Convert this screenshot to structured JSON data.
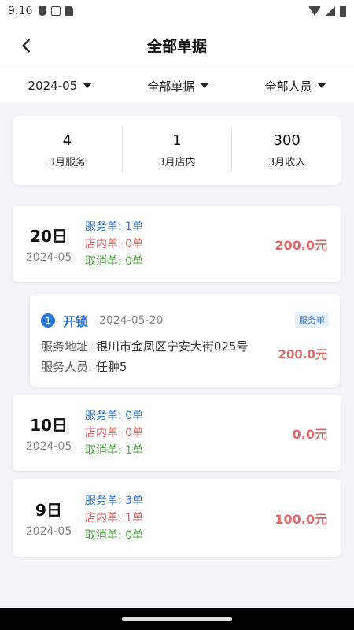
{
  "status_bar": {
    "time": "9:16"
  },
  "header": {
    "title": "全部单据"
  },
  "filters": [
    {
      "label": "2024-05"
    },
    {
      "label": "全部单据"
    },
    {
      "label": "全部人员"
    }
  ],
  "summary": [
    {
      "value": "4",
      "label": "3月服务"
    },
    {
      "value": "1",
      "label": "3月店内"
    },
    {
      "value": "300",
      "label": "3月收入"
    }
  ],
  "day_cards": [
    {
      "day": "20日",
      "ym": "2024-05",
      "service": "服务单: 1单",
      "instore": "店内单: 0单",
      "cancel": "取消单: 0单",
      "amount": "200.0元"
    },
    {
      "day": "10日",
      "ym": "2024-05",
      "service": "服务单: 0单",
      "instore": "店内单: 0单",
      "cancel": "取消单: 1单",
      "amount": "0.0元"
    },
    {
      "day": "9日",
      "ym": "2024-05",
      "service": "服务单: 3单",
      "instore": "店内单: 1单",
      "cancel": "取消单: 0单",
      "amount": "100.0元"
    }
  ],
  "detail": {
    "index": "1",
    "title": "开锁",
    "date": "2024-05-20",
    "tag": "服务单",
    "address_label": "服务地址: ",
    "address": "银川市金凤区宁安大街025号",
    "staff_label": "服务人员: ",
    "staff": "任翀5",
    "amount": "200.0元"
  },
  "colors": {
    "blue": "#2f7ad6",
    "red": "#e06666",
    "green": "#4aa63a",
    "amount": "#e06a6a"
  },
  "icons": {
    "back": "chevron-left-icon",
    "dropdown": "caret-down-icon"
  }
}
